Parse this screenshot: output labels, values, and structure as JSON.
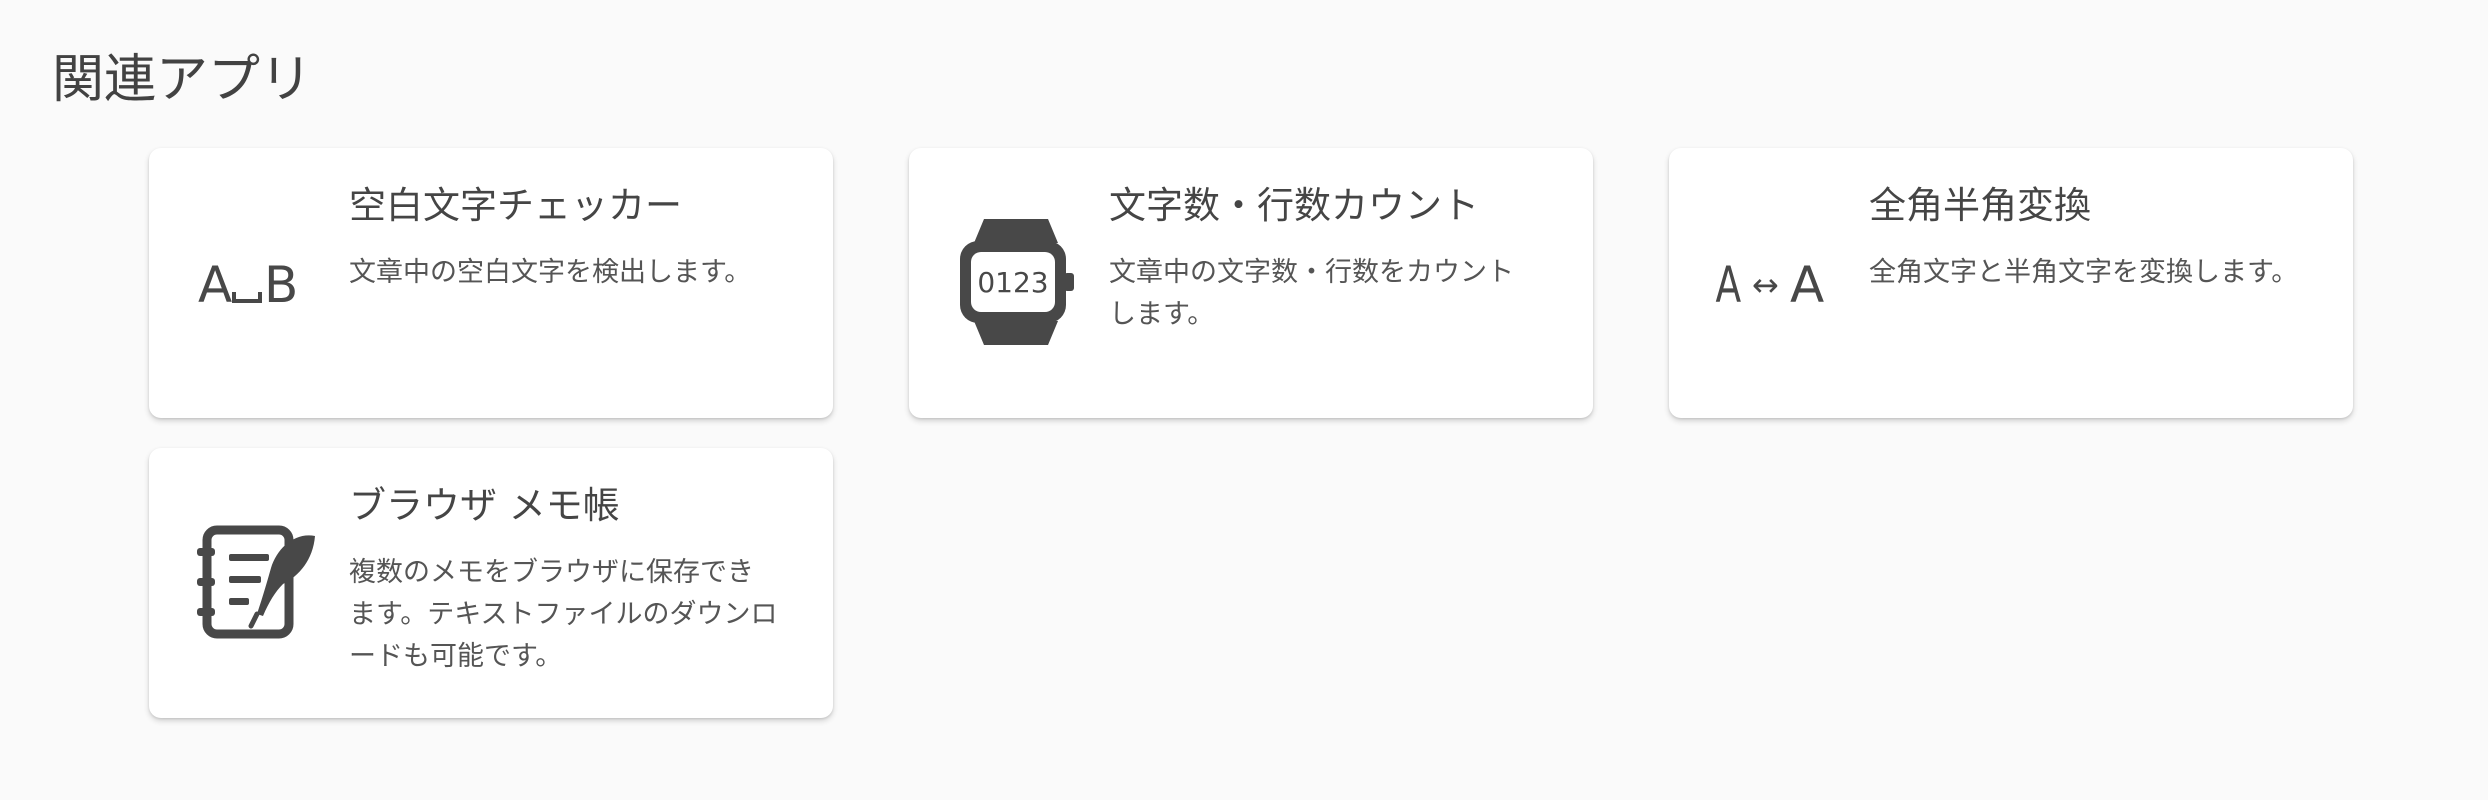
{
  "section": {
    "title": "関連アプリ"
  },
  "cards": [
    {
      "title": "空白文字チェッカー",
      "description": "文章中の空白文字を検出します。",
      "icon": "space-character-icon",
      "icon_text": "A␣B"
    },
    {
      "title": "文字数・行数カウント",
      "description": "文章中の文字数・行数をカウントします。",
      "icon": "counter-watch-icon",
      "icon_text": "0123"
    },
    {
      "title": "全角半角変換",
      "description": "全角文字と半角文字を変換します。",
      "icon": "width-convert-icon",
      "icon_text": "A↔A"
    },
    {
      "title": "ブラウザ メモ帳",
      "description": "複数のメモをブラウザに保存できます。テキストファイルのダウンロードも可能です。",
      "icon": "notebook-quill-icon"
    }
  ],
  "colors": {
    "background": "#fafafa",
    "card": "#ffffff",
    "text": "#424242",
    "icon": "#484848"
  }
}
